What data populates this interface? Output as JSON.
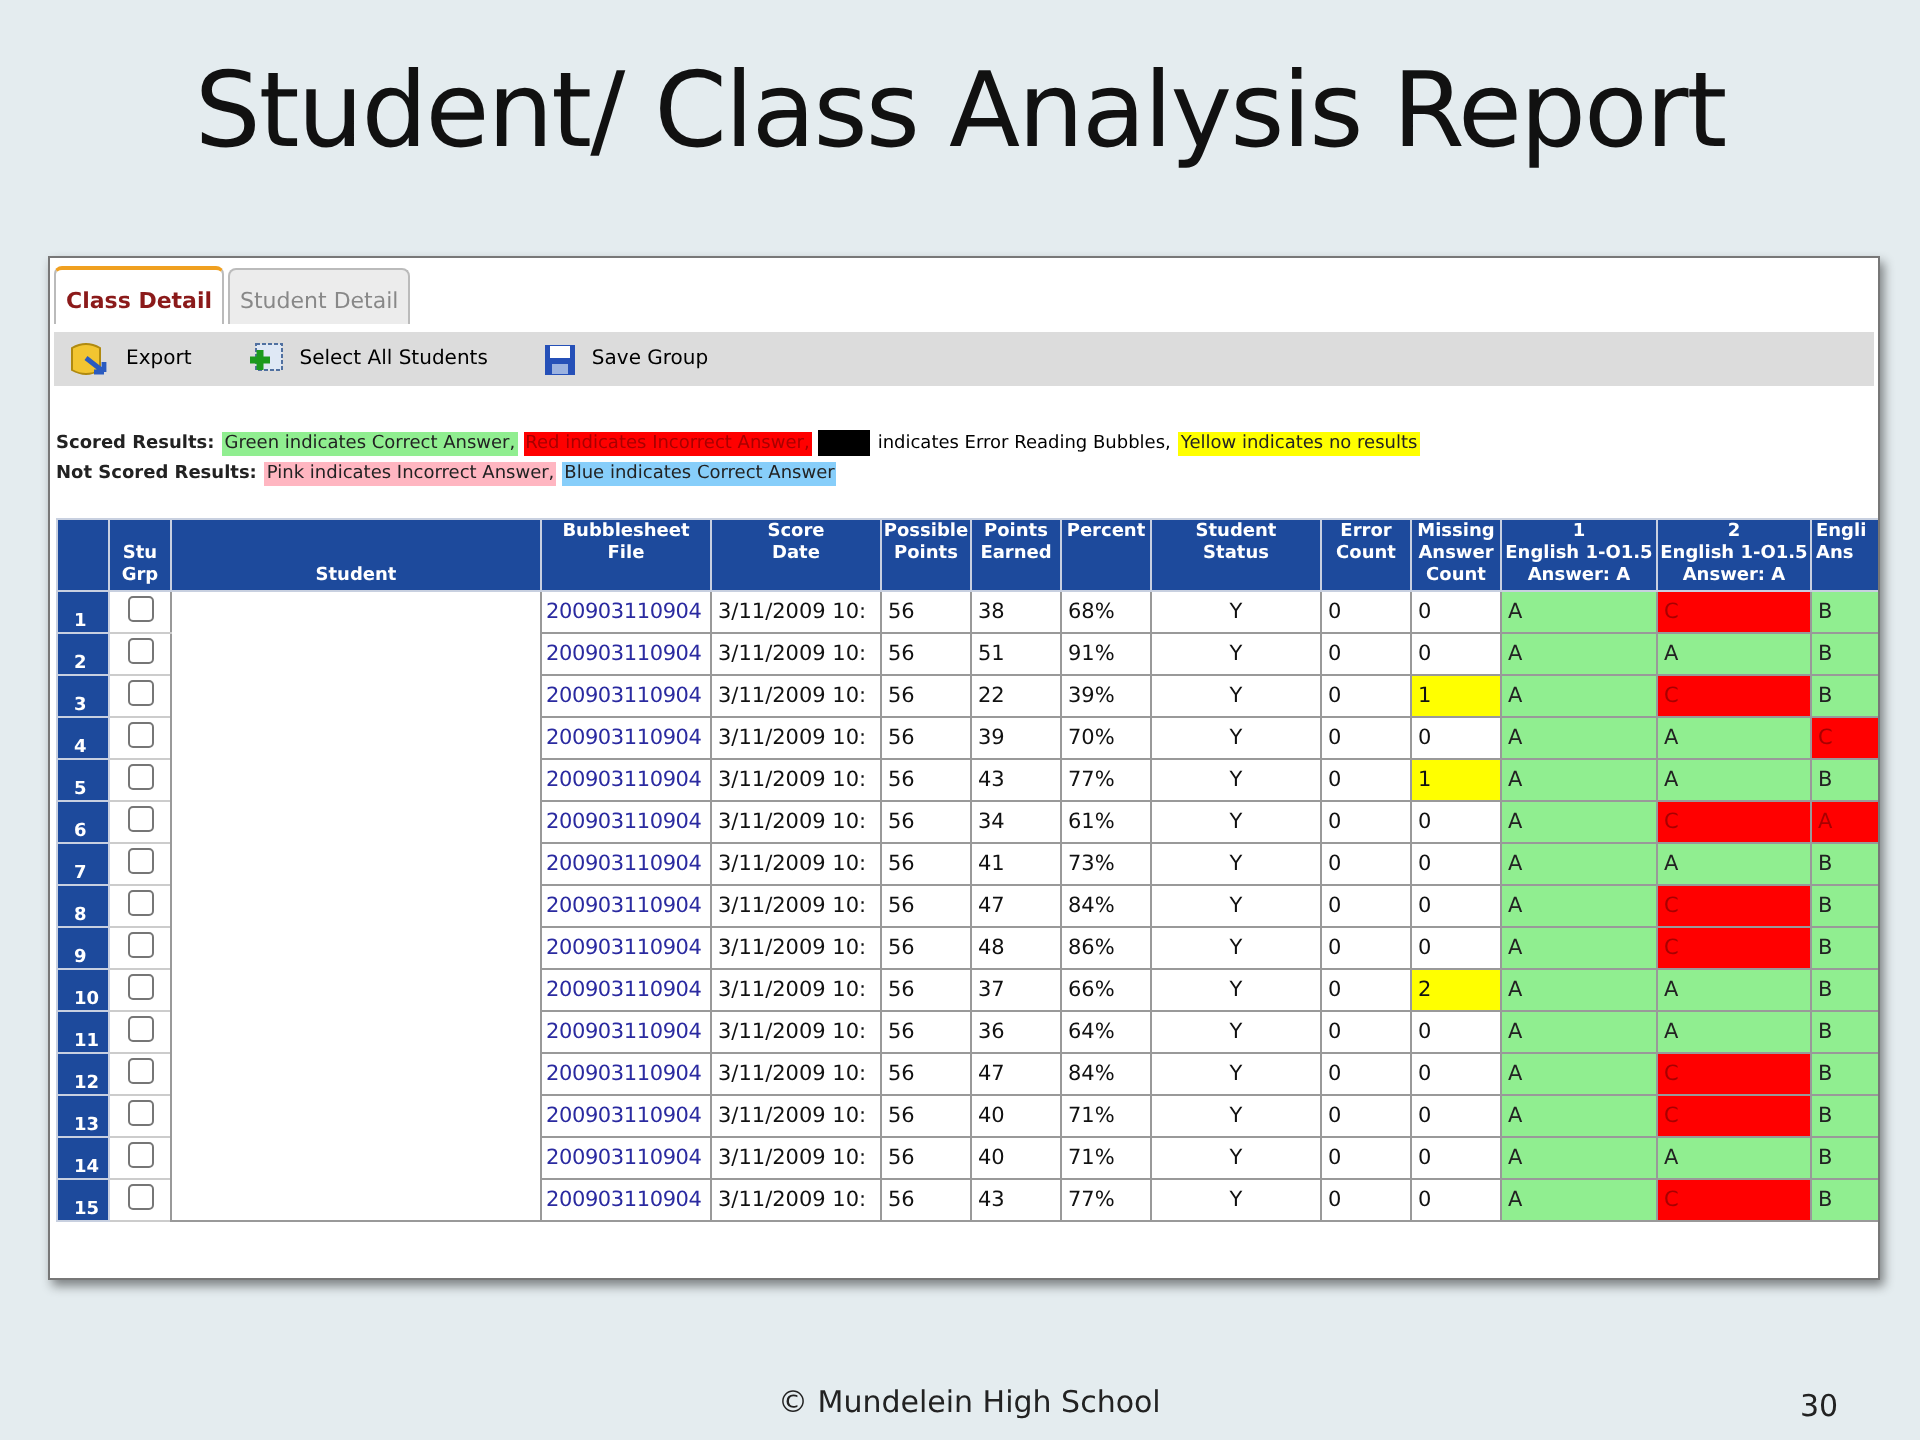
{
  "slide": {
    "title": "Student/ Class Analysis Report",
    "footer": "© Mundelein High School",
    "page_number": "30"
  },
  "tabs": [
    {
      "label": "Class Detail",
      "selected": true
    },
    {
      "label": "Student Detail",
      "selected": false
    }
  ],
  "toolbar": [
    {
      "kind": "export",
      "label": "Export"
    },
    {
      "kind": "select-all",
      "label": "Select All Students"
    },
    {
      "kind": "save",
      "label": "Save Group"
    }
  ],
  "legend": [
    {
      "label": "Scored Results:",
      "items": [
        {
          "text": "Green indicates Correct Answer,",
          "color": "#90ee90"
        },
        {
          "text": "Red indicates Incorrect Answer,",
          "color": "#ff0000"
        },
        {
          "color": "#000000"
        },
        {
          "text": "indicates Error Reading Bubbles,"
        },
        {
          "text": "Yellow indicates no results",
          "color": "#ffff00"
        }
      ]
    },
    {
      "label": "Not Scored Results:",
      "items": [
        {
          "text": "Pink indicates Incorrect Answer,",
          "color": "#ffb6c1"
        },
        {
          "text": "Blue indicates Correct Answer",
          "color": "#87cefa"
        }
      ]
    }
  ],
  "table": {
    "columns": [
      "",
      "Stu\nGrp",
      "Student",
      "Bubblesheet File",
      "Score\nDate",
      "Possible\nPoints",
      "Points\nEarned",
      "Percent",
      "Student\nStatus",
      "Error\nCount",
      "Missing\nAnswer\nCount",
      "1\nEnglish 1-O1.5\nAnswer: A",
      "2\nEnglish 1-O1.5\nAnswer: A",
      "Engli\nAns"
    ],
    "rows": [
      {
        "number": "1",
        "checked": false,
        "file": "200903110904",
        "date": "3/11/2009 10:",
        "possible": "56",
        "earned": "38",
        "percent": "68%",
        "status": "Y",
        "errors": "0",
        "missing": {
          "value": "0"
        },
        "answers": [
          {
            "value": "A",
            "color": "#90ee90"
          },
          {
            "value": "C",
            "color": "#ff0000"
          },
          {
            "value": "B",
            "color": "#90ee90"
          }
        ]
      },
      {
        "number": "2",
        "checked": false,
        "file": "200903110904",
        "date": "3/11/2009 10:",
        "possible": "56",
        "earned": "51",
        "percent": "91%",
        "status": "Y",
        "errors": "0",
        "missing": {
          "value": "0"
        },
        "answers": [
          {
            "value": "A",
            "color": "#90ee90"
          },
          {
            "value": "A",
            "color": "#90ee90"
          },
          {
            "value": "B",
            "color": "#90ee90"
          }
        ]
      },
      {
        "number": "3",
        "checked": false,
        "file": "200903110904",
        "date": "3/11/2009 10:",
        "possible": "56",
        "earned": "22",
        "percent": "39%",
        "status": "Y",
        "errors": "0",
        "missing": {
          "value": "1",
          "color": "#ffff00"
        },
        "answers": [
          {
            "value": "A",
            "color": "#90ee90"
          },
          {
            "value": "C",
            "color": "#ff0000"
          },
          {
            "value": "B",
            "color": "#90ee90"
          }
        ]
      },
      {
        "number": "4",
        "checked": false,
        "file": "200903110904",
        "date": "3/11/2009 10:",
        "possible": "56",
        "earned": "39",
        "percent": "70%",
        "status": "Y",
        "errors": "0",
        "missing": {
          "value": "0"
        },
        "answers": [
          {
            "value": "A",
            "color": "#90ee90"
          },
          {
            "value": "A",
            "color": "#90ee90"
          },
          {
            "value": "C",
            "color": "#ff0000"
          }
        ]
      },
      {
        "number": "5",
        "checked": false,
        "file": "200903110904",
        "date": "3/11/2009 10:",
        "possible": "56",
        "earned": "43",
        "percent": "77%",
        "status": "Y",
        "errors": "0",
        "missing": {
          "value": "1",
          "color": "#ffff00"
        },
        "answers": [
          {
            "value": "A",
            "color": "#90ee90"
          },
          {
            "value": "A",
            "color": "#90ee90"
          },
          {
            "value": "B",
            "color": "#90ee90"
          }
        ]
      },
      {
        "number": "6",
        "checked": false,
        "file": "200903110904",
        "date": "3/11/2009 10:",
        "possible": "56",
        "earned": "34",
        "percent": "61%",
        "status": "Y",
        "errors": "0",
        "missing": {
          "value": "0"
        },
        "answers": [
          {
            "value": "A",
            "color": "#90ee90"
          },
          {
            "value": "C",
            "color": "#ff0000"
          },
          {
            "value": "A",
            "color": "#ff0000"
          }
        ]
      },
      {
        "number": "7",
        "checked": false,
        "file": "200903110904",
        "date": "3/11/2009 10:",
        "possible": "56",
        "earned": "41",
        "percent": "73%",
        "status": "Y",
        "errors": "0",
        "missing": {
          "value": "0"
        },
        "answers": [
          {
            "value": "A",
            "color": "#90ee90"
          },
          {
            "value": "A",
            "color": "#90ee90"
          },
          {
            "value": "B",
            "color": "#90ee90"
          }
        ]
      },
      {
        "number": "8",
        "checked": false,
        "file": "200903110904",
        "date": "3/11/2009 10:",
        "possible": "56",
        "earned": "47",
        "percent": "84%",
        "status": "Y",
        "errors": "0",
        "missing": {
          "value": "0"
        },
        "answers": [
          {
            "value": "A",
            "color": "#90ee90"
          },
          {
            "value": "C",
            "color": "#ff0000"
          },
          {
            "value": "B",
            "color": "#90ee90"
          }
        ]
      },
      {
        "number": "9",
        "checked": false,
        "file": "200903110904",
        "date": "3/11/2009 10:",
        "possible": "56",
        "earned": "48",
        "percent": "86%",
        "status": "Y",
        "errors": "0",
        "missing": {
          "value": "0"
        },
        "answers": [
          {
            "value": "A",
            "color": "#90ee90"
          },
          {
            "value": "C",
            "color": "#ff0000"
          },
          {
            "value": "B",
            "color": "#90ee90"
          }
        ]
      },
      {
        "number": "10",
        "checked": false,
        "file": "200903110904",
        "date": "3/11/2009 10:",
        "possible": "56",
        "earned": "37",
        "percent": "66%",
        "status": "Y",
        "errors": "0",
        "missing": {
          "value": "2",
          "color": "#ffff00"
        },
        "answers": [
          {
            "value": "A",
            "color": "#90ee90"
          },
          {
            "value": "A",
            "color": "#90ee90"
          },
          {
            "value": "B",
            "color": "#90ee90"
          }
        ]
      },
      {
        "number": "11",
        "checked": false,
        "file": "200903110904",
        "date": "3/11/2009 10:",
        "possible": "56",
        "earned": "36",
        "percent": "64%",
        "status": "Y",
        "errors": "0",
        "missing": {
          "value": "0"
        },
        "answers": [
          {
            "value": "A",
            "color": "#90ee90"
          },
          {
            "value": "A",
            "color": "#90ee90"
          },
          {
            "value": "B",
            "color": "#90ee90"
          }
        ]
      },
      {
        "number": "12",
        "checked": false,
        "file": "200903110904",
        "date": "3/11/2009 10:",
        "possible": "56",
        "earned": "47",
        "percent": "84%",
        "status": "Y",
        "errors": "0",
        "missing": {
          "value": "0"
        },
        "answers": [
          {
            "value": "A",
            "color": "#90ee90"
          },
          {
            "value": "C",
            "color": "#ff0000"
          },
          {
            "value": "B",
            "color": "#90ee90"
          }
        ]
      },
      {
        "number": "13",
        "checked": false,
        "file": "200903110904",
        "date": "3/11/2009 10:",
        "possible": "56",
        "earned": "40",
        "percent": "71%",
        "status": "Y",
        "errors": "0",
        "missing": {
          "value": "0"
        },
        "answers": [
          {
            "value": "A",
            "color": "#90ee90"
          },
          {
            "value": "C",
            "color": "#ff0000"
          },
          {
            "value": "B",
            "color": "#90ee90"
          }
        ]
      },
      {
        "number": "14",
        "checked": false,
        "file": "200903110904",
        "date": "3/11/2009 10:",
        "possible": "56",
        "earned": "40",
        "percent": "71%",
        "status": "Y",
        "errors": "0",
        "missing": {
          "value": "0"
        },
        "answers": [
          {
            "value": "A",
            "color": "#90ee90"
          },
          {
            "value": "A",
            "color": "#90ee90"
          },
          {
            "value": "B",
            "color": "#90ee90"
          }
        ]
      },
      {
        "number": "15",
        "checked": false,
        "file": "200903110904",
        "date": "3/11/2009 10:",
        "possible": "56",
        "earned": "43",
        "percent": "77%",
        "status": "Y",
        "errors": "0",
        "missing": {
          "value": "0"
        },
        "answers": [
          {
            "value": "A",
            "color": "#90ee90"
          },
          {
            "value": "C",
            "color": "#ff0000"
          },
          {
            "value": "B",
            "color": "#90ee90"
          }
        ]
      }
    ]
  }
}
